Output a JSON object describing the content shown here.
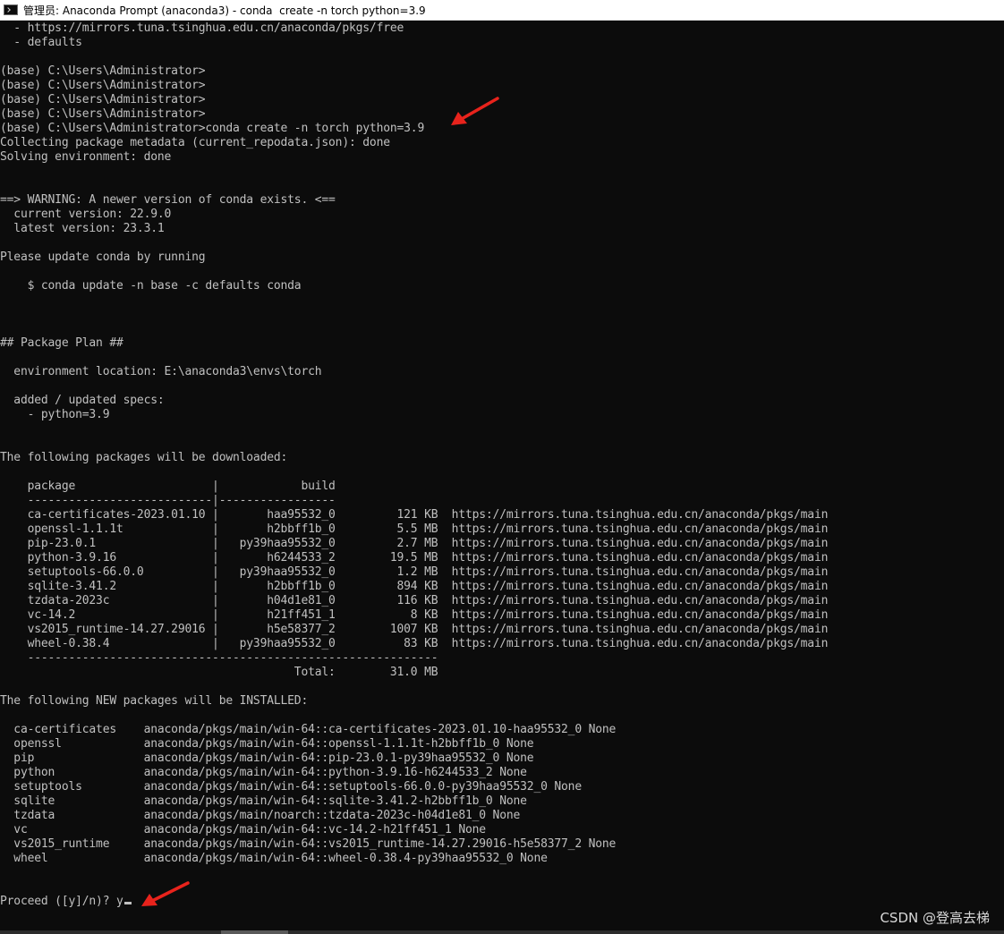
{
  "window": {
    "title": "管理员: Anaconda Prompt (anaconda3) - conda  create -n torch python=3.9"
  },
  "console": {
    "lines": [
      "  - https://mirrors.tuna.tsinghua.edu.cn/anaconda/pkgs/free",
      "  - defaults",
      "",
      "(base) C:\\Users\\Administrator>",
      "(base) C:\\Users\\Administrator>",
      "(base) C:\\Users\\Administrator>",
      "(base) C:\\Users\\Administrator>",
      "(base) C:\\Users\\Administrator>conda create -n torch python=3.9",
      "Collecting package metadata (current_repodata.json): done",
      "Solving environment: done",
      "",
      "",
      "==> WARNING: A newer version of conda exists. <==",
      "  current version: 22.9.0",
      "  latest version: 23.3.1",
      "",
      "Please update conda by running",
      "",
      "    $ conda update -n base -c defaults conda",
      "",
      "",
      "",
      "## Package Plan ##",
      "",
      "  environment location: E:\\anaconda3\\envs\\torch",
      "",
      "  added / updated specs:",
      "    - python=3.9",
      "",
      "",
      "The following packages will be downloaded:",
      "",
      "    package                    |            build",
      "    ---------------------------|-----------------",
      "    ca-certificates-2023.01.10 |       haa95532_0         121 KB  https://mirrors.tuna.tsinghua.edu.cn/anaconda/pkgs/main",
      "    openssl-1.1.1t             |       h2bbff1b_0         5.5 MB  https://mirrors.tuna.tsinghua.edu.cn/anaconda/pkgs/main",
      "    pip-23.0.1                 |   py39haa95532_0         2.7 MB  https://mirrors.tuna.tsinghua.edu.cn/anaconda/pkgs/main",
      "    python-3.9.16              |       h6244533_2        19.5 MB  https://mirrors.tuna.tsinghua.edu.cn/anaconda/pkgs/main",
      "    setuptools-66.0.0          |   py39haa95532_0         1.2 MB  https://mirrors.tuna.tsinghua.edu.cn/anaconda/pkgs/main",
      "    sqlite-3.41.2              |       h2bbff1b_0         894 KB  https://mirrors.tuna.tsinghua.edu.cn/anaconda/pkgs/main",
      "    tzdata-2023c               |       h04d1e81_0         116 KB  https://mirrors.tuna.tsinghua.edu.cn/anaconda/pkgs/main",
      "    vc-14.2                    |       h21ff451_1           8 KB  https://mirrors.tuna.tsinghua.edu.cn/anaconda/pkgs/main",
      "    vs2015_runtime-14.27.29016 |       h5e58377_2        1007 KB  https://mirrors.tuna.tsinghua.edu.cn/anaconda/pkgs/main",
      "    wheel-0.38.4               |   py39haa95532_0          83 KB  https://mirrors.tuna.tsinghua.edu.cn/anaconda/pkgs/main",
      "    ------------------------------------------------------------",
      "                                           Total:        31.0 MB",
      "",
      "The following NEW packages will be INSTALLED:",
      "",
      "  ca-certificates    anaconda/pkgs/main/win-64::ca-certificates-2023.01.10-haa95532_0 None",
      "  openssl            anaconda/pkgs/main/win-64::openssl-1.1.1t-h2bbff1b_0 None",
      "  pip                anaconda/pkgs/main/win-64::pip-23.0.1-py39haa95532_0 None",
      "  python             anaconda/pkgs/main/win-64::python-3.9.16-h6244533_2 None",
      "  setuptools         anaconda/pkgs/main/win-64::setuptools-66.0.0-py39haa95532_0 None",
      "  sqlite             anaconda/pkgs/main/win-64::sqlite-3.41.2-h2bbff1b_0 None",
      "  tzdata             anaconda/pkgs/main/noarch::tzdata-2023c-h04d1e81_0 None",
      "  vc                 anaconda/pkgs/main/win-64::vc-14.2-h21ff451_1 None",
      "  vs2015_runtime     anaconda/pkgs/main/win-64::vs2015_runtime-14.27.29016-h5e58377_2 None",
      "  wheel              anaconda/pkgs/main/win-64::wheel-0.38.4-py39haa95532_0 None",
      "",
      "",
      "Proceed ([y]/n)? y"
    ]
  },
  "annotation": {
    "arrow_color": "#e8231c"
  },
  "watermark": {
    "text": "CSDN @登高去梯"
  }
}
